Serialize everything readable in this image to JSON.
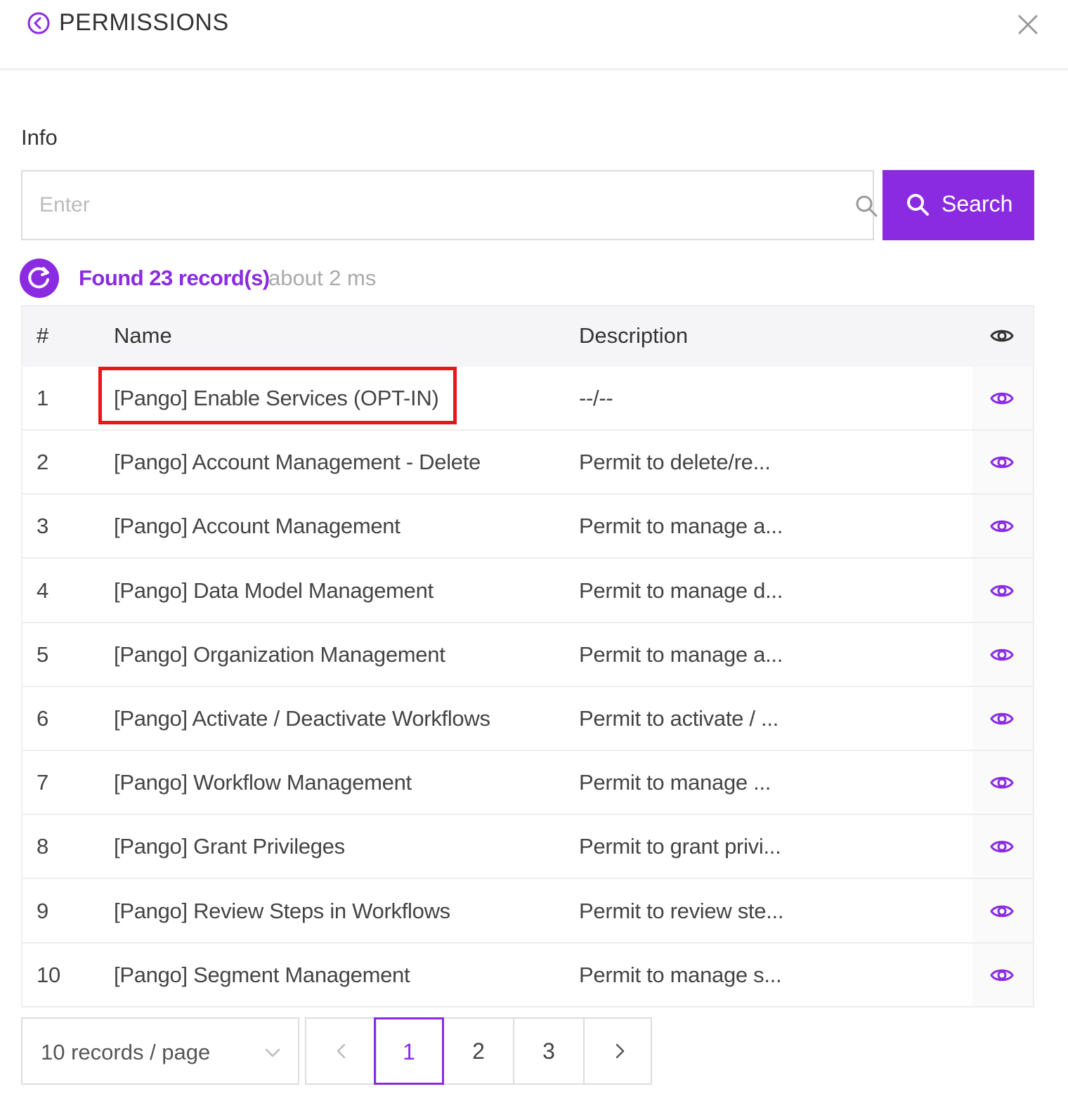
{
  "header": {
    "title": "PERMISSIONS"
  },
  "section_label": "Info",
  "search": {
    "placeholder": "Enter",
    "value": "",
    "button_label": "Search"
  },
  "status": {
    "count_text": "Found 23 record(s)",
    "time_text": "about 2 ms"
  },
  "table": {
    "columns": {
      "num": "#",
      "name": "Name",
      "description": "Description"
    },
    "rows": [
      {
        "num": "1",
        "name": "[Pango] Enable Services (OPT-IN)",
        "description": "--/--",
        "highlighted": true
      },
      {
        "num": "2",
        "name": "[Pango] Account Management - Delete",
        "description": "Permit to delete/re..."
      },
      {
        "num": "3",
        "name": "[Pango] Account Management",
        "description": "Permit to manage a..."
      },
      {
        "num": "4",
        "name": "[Pango] Data Model Management",
        "description": "Permit to manage d..."
      },
      {
        "num": "5",
        "name": "[Pango] Organization Management",
        "description": "Permit to manage a..."
      },
      {
        "num": "6",
        "name": "[Pango] Activate / Deactivate Workflows",
        "description": "Permit to activate / ..."
      },
      {
        "num": "7",
        "name": "[Pango] Workflow Management",
        "description": "Permit to manage ..."
      },
      {
        "num": "8",
        "name": "[Pango] Grant Privileges",
        "description": "Permit to grant privi..."
      },
      {
        "num": "9",
        "name": "[Pango] Review Steps in Workflows",
        "description": "Permit to review ste..."
      },
      {
        "num": "10",
        "name": "[Pango] Segment Management",
        "description": "Permit to manage s..."
      }
    ]
  },
  "pagination": {
    "page_size_label": "10 records / page",
    "pages": [
      "1",
      "2",
      "3"
    ],
    "current_page": "1"
  },
  "colors": {
    "accent": "#8a2be2",
    "highlight": "#e8151b",
    "header_bg": "#f5f5f7"
  },
  "icons": {
    "back": "back-circle-icon",
    "close": "close-icon",
    "search": "search-icon",
    "refresh": "refresh-icon",
    "view": "eye-icon",
    "dropdown": "chevron-down-icon",
    "prev": "chevron-left-icon",
    "next": "chevron-right-icon"
  }
}
